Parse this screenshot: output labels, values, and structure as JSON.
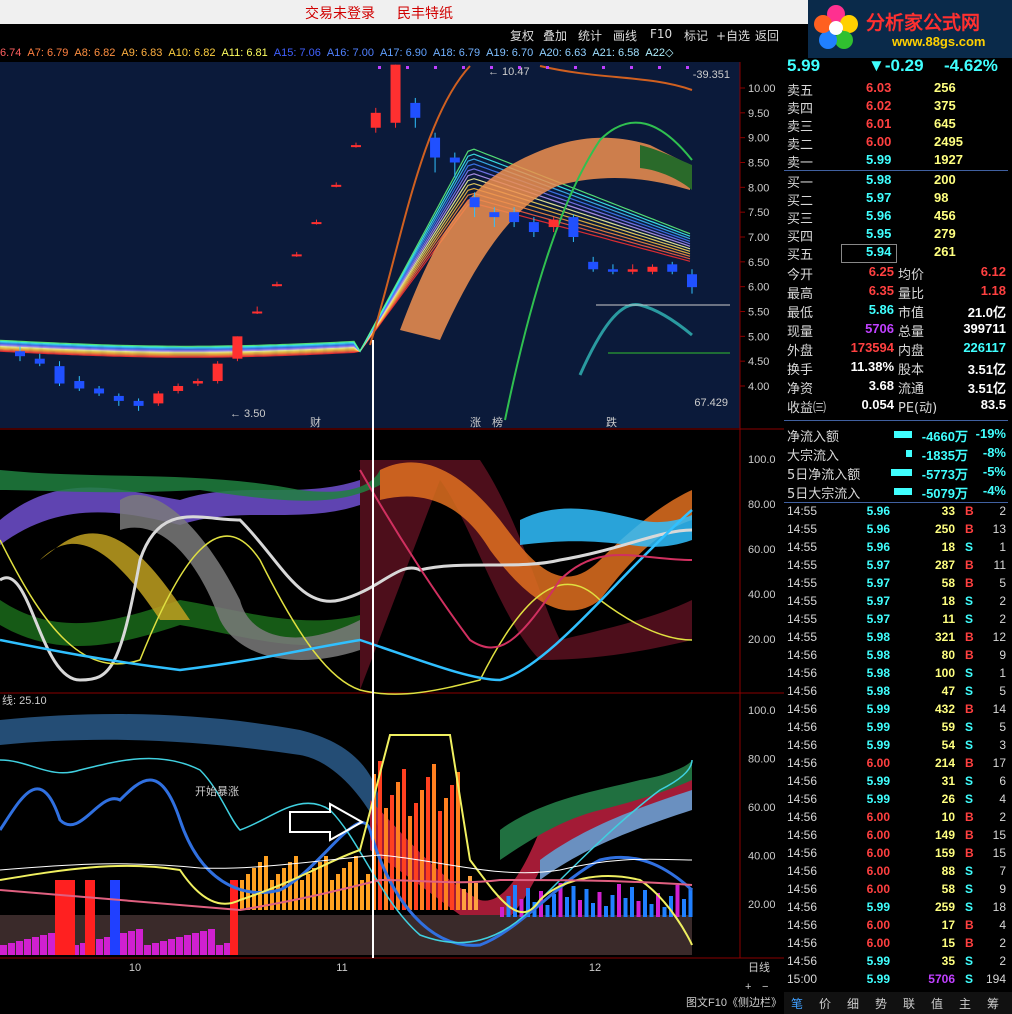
{
  "topbar": {
    "login": "交易未登录",
    "paper": "民丰特纸"
  },
  "logo": {
    "title": "分析家公式网",
    "url": "www.88gs.com"
  },
  "toolbar": [
    "复权",
    "叠加",
    "统计",
    "画线",
    "F10",
    "标记",
    "+自选",
    "返回"
  ],
  "ma_row": [
    {
      "t": "6.74",
      "c": "#ff6060"
    },
    {
      "t": "A7: 6.79",
      "c": "#ff8040"
    },
    {
      "t": "A8: 6.82",
      "c": "#ff9040"
    },
    {
      "t": "A9: 6.83",
      "c": "#ffb040"
    },
    {
      "t": "A10: 6.82",
      "c": "#ffd040"
    },
    {
      "t": "A11: 6.81",
      "c": "#ffff60"
    },
    {
      "t": "A15: 7.06",
      "c": "#4060ff"
    },
    {
      "t": "A16: 7.00",
      "c": "#5080ff"
    },
    {
      "t": "A17: 6.90",
      "c": "#60a0ff"
    },
    {
      "t": "A18: 6.79",
      "c": "#70b0ff"
    },
    {
      "t": "A19: 6.70",
      "c": "#80c0ff"
    },
    {
      "t": "A20: 6.63",
      "c": "#90d0ff"
    },
    {
      "t": "A21: 6.58",
      "c": "#a0e0ff"
    },
    {
      "t": "A22◇",
      "c": "#b0f0ff"
    }
  ],
  "main_chart": {
    "y_ticks": [
      "10.00",
      "9.50",
      "9.00",
      "8.50",
      "8.00",
      "7.50",
      "7.00",
      "6.50",
      "6.00",
      "5.50",
      "5.00",
      "4.50",
      "4.00"
    ],
    "high_label": "10.47",
    "low_label": "3.50",
    "top_right_value": "-39.351",
    "bottom_right_value": "67.429",
    "markers": [
      {
        "t": "财",
        "c": "#4080ff"
      },
      {
        "t": "涨",
        "c": "#ff3030"
      },
      {
        "t": "榜",
        "c": "#ff8000"
      },
      {
        "t": "跌",
        "c": "#30ff30"
      }
    ],
    "candles": [
      {
        "o": 4.7,
        "c": 4.6,
        "h": 4.8,
        "l": 4.5
      },
      {
        "o": 4.55,
        "c": 4.45,
        "h": 4.65,
        "l": 4.4
      },
      {
        "o": 4.4,
        "c": 4.05,
        "h": 4.5,
        "l": 4.0
      },
      {
        "o": 4.1,
        "c": 3.95,
        "h": 4.2,
        "l": 3.9
      },
      {
        "o": 3.95,
        "c": 3.85,
        "h": 4.0,
        "l": 3.8
      },
      {
        "o": 3.8,
        "c": 3.7,
        "h": 3.85,
        "l": 3.6
      },
      {
        "o": 3.7,
        "c": 3.6,
        "h": 3.75,
        "l": 3.5
      },
      {
        "o": 3.65,
        "c": 3.85,
        "h": 3.9,
        "l": 3.6
      },
      {
        "o": 3.9,
        "c": 4.0,
        "h": 4.05,
        "l": 3.85
      },
      {
        "o": 4.05,
        "c": 4.1,
        "h": 4.15,
        "l": 4.0
      },
      {
        "o": 4.1,
        "c": 4.45,
        "h": 4.5,
        "l": 4.05
      },
      {
        "o": 4.55,
        "c": 5.0,
        "h": 5.0,
        "l": 4.5
      },
      {
        "o": 5.5,
        "c": 5.5,
        "h": 5.6,
        "l": 5.45
      },
      {
        "o": 6.05,
        "c": 6.05,
        "h": 6.1,
        "l": 6.0
      },
      {
        "o": 6.65,
        "c": 6.65,
        "h": 6.7,
        "l": 6.6
      },
      {
        "o": 7.3,
        "c": 7.3,
        "h": 7.35,
        "l": 7.25
      },
      {
        "o": 8.05,
        "c": 8.05,
        "h": 8.1,
        "l": 8.0
      },
      {
        "o": 8.85,
        "c": 8.85,
        "h": 8.9,
        "l": 8.8
      },
      {
        "o": 9.2,
        "c": 9.5,
        "h": 9.6,
        "l": 9.1
      },
      {
        "o": 9.3,
        "c": 10.47,
        "h": 10.47,
        "l": 9.2
      },
      {
        "o": 9.7,
        "c": 9.4,
        "h": 9.8,
        "l": 9.2
      },
      {
        "o": 9.0,
        "c": 8.6,
        "h": 9.1,
        "l": 8.3
      },
      {
        "o": 8.6,
        "c": 8.5,
        "h": 8.7,
        "l": 8.2
      },
      {
        "o": 7.8,
        "c": 7.6,
        "h": 7.9,
        "l": 7.4
      },
      {
        "o": 7.5,
        "c": 7.4,
        "h": 7.6,
        "l": 7.2
      },
      {
        "o": 7.5,
        "c": 7.3,
        "h": 7.6,
        "l": 7.2
      },
      {
        "o": 7.3,
        "c": 7.1,
        "h": 7.4,
        "l": 7.0
      },
      {
        "o": 7.2,
        "c": 7.35,
        "h": 7.4,
        "l": 7.1
      },
      {
        "o": 7.4,
        "c": 7.0,
        "h": 7.45,
        "l": 6.9
      },
      {
        "o": 6.5,
        "c": 6.35,
        "h": 6.6,
        "l": 6.3
      },
      {
        "o": 6.35,
        "c": 6.3,
        "h": 6.45,
        "l": 6.25
      },
      {
        "o": 6.3,
        "c": 6.35,
        "h": 6.45,
        "l": 6.25
      },
      {
        "o": 6.3,
        "c": 6.4,
        "h": 6.45,
        "l": 6.25
      },
      {
        "o": 6.45,
        "c": 6.3,
        "h": 6.5,
        "l": 6.25
      },
      {
        "o": 6.25,
        "c": 5.99,
        "h": 6.35,
        "l": 5.86
      }
    ]
  },
  "ind1": {
    "y_ticks": [
      "100.0",
      "80.00",
      "60.00",
      "40.00",
      "20.00"
    ]
  },
  "ind2": {
    "label": "线: 25.10",
    "y_ticks": [
      "100.0",
      "80.00",
      "60.00",
      "40.00",
      "20.00"
    ]
  },
  "x_ticks": [
    "10",
    "11",
    "12"
  ],
  "annotation": "开始暴涨",
  "period": "日线",
  "bottom_left": "图文F10《侧边栏》",
  "quote": {
    "price": "5.99",
    "change": "▼-0.29",
    "pct": "-4.62%",
    "asks": [
      {
        "label": "卖五",
        "price": "6.03",
        "vol": "256"
      },
      {
        "label": "卖四",
        "price": "6.02",
        "vol": "375"
      },
      {
        "label": "卖三",
        "price": "6.01",
        "vol": "645"
      },
      {
        "label": "卖二",
        "price": "6.00",
        "vol": "2495"
      },
      {
        "label": "卖一",
        "price": "5.99",
        "vol": "1927"
      }
    ],
    "bids": [
      {
        "label": "买一",
        "price": "5.98",
        "vol": "200"
      },
      {
        "label": "买二",
        "price": "5.97",
        "vol": "98"
      },
      {
        "label": "买三",
        "price": "5.96",
        "vol": "456"
      },
      {
        "label": "买四",
        "price": "5.95",
        "vol": "279"
      },
      {
        "label": "买五",
        "price": "5.94",
        "vol": "261"
      }
    ],
    "stats": [
      {
        "l1": "今开",
        "v1": "6.25",
        "c1": "#ff4040",
        "l2": "均价",
        "v2": "6.12",
        "c2": "#ff4040"
      },
      {
        "l1": "最高",
        "v1": "6.35",
        "c1": "#ff4040",
        "l2": "量比",
        "v2": "1.18",
        "c2": "#ff4040"
      },
      {
        "l1": "最低",
        "v1": "5.86",
        "c1": "#40ffff",
        "l2": "市值",
        "v2": "21.0亿",
        "c2": "#ffffff"
      },
      {
        "l1": "现量",
        "v1": "5706",
        "c1": "#c040ff",
        "l2": "总量",
        "v2": "399711",
        "c2": "#ffffff"
      },
      {
        "l1": "外盘",
        "v1": "173594",
        "c1": "#ff4040",
        "l2": "内盘",
        "v2": "226117",
        "c2": "#40ffff"
      },
      {
        "l1": "换手",
        "v1": "11.38%",
        "c1": "#ffffff",
        "l2": "股本",
        "v2": "3.51亿",
        "c2": "#ffffff"
      },
      {
        "l1": "净资",
        "v1": "3.68",
        "c1": "#ffffff",
        "l2": "流通",
        "v2": "3.51亿",
        "c2": "#ffffff"
      },
      {
        "l1": "收益㈢",
        "v1": "0.054",
        "c1": "#ffffff",
        "l2": "PE(动)",
        "v2": "83.5",
        "c2": "#ffffff"
      }
    ],
    "flows": [
      {
        "label": "净流入额",
        "bar": 0.6,
        "val": "-4660万",
        "pct": "-19%"
      },
      {
        "label": "大宗流入",
        "bar": 0.2,
        "val": "-1835万",
        "pct": "-8%"
      },
      {
        "label": "5日净流入额",
        "bar": 0.7,
        "val": "-5773万",
        "pct": "-5%"
      },
      {
        "label": "5日大宗流入",
        "bar": 0.6,
        "val": "-5079万",
        "pct": "-4%"
      }
    ]
  },
  "ticks": [
    [
      "14:55",
      "5.96",
      "33",
      "B",
      "2"
    ],
    [
      "14:55",
      "5.96",
      "250",
      "B",
      "13"
    ],
    [
      "14:55",
      "5.96",
      "18",
      "S",
      "1"
    ],
    [
      "14:55",
      "5.97",
      "287",
      "B",
      "11"
    ],
    [
      "14:55",
      "5.97",
      "58",
      "B",
      "5"
    ],
    [
      "14:55",
      "5.97",
      "18",
      "S",
      "2"
    ],
    [
      "14:55",
      "5.97",
      "11",
      "S",
      "2"
    ],
    [
      "14:55",
      "5.98",
      "321",
      "B",
      "12"
    ],
    [
      "14:56",
      "5.98",
      "80",
      "B",
      "9"
    ],
    [
      "14:56",
      "5.98",
      "100",
      "S",
      "1"
    ],
    [
      "14:56",
      "5.98",
      "47",
      "S",
      "5"
    ],
    [
      "14:56",
      "5.99",
      "432",
      "B",
      "14"
    ],
    [
      "14:56",
      "5.99",
      "59",
      "S",
      "5"
    ],
    [
      "14:56",
      "5.99",
      "54",
      "S",
      "3"
    ],
    [
      "14:56",
      "6.00",
      "214",
      "B",
      "17"
    ],
    [
      "14:56",
      "5.99",
      "31",
      "S",
      "6"
    ],
    [
      "14:56",
      "5.99",
      "26",
      "S",
      "4"
    ],
    [
      "14:56",
      "6.00",
      "10",
      "B",
      "2"
    ],
    [
      "14:56",
      "6.00",
      "149",
      "B",
      "15"
    ],
    [
      "14:56",
      "6.00",
      "159",
      "B",
      "15"
    ],
    [
      "14:56",
      "6.00",
      "88",
      "S",
      "7"
    ],
    [
      "14:56",
      "6.00",
      "58",
      "S",
      "9"
    ],
    [
      "14:56",
      "5.99",
      "259",
      "S",
      "18"
    ],
    [
      "14:56",
      "6.00",
      "17",
      "B",
      "4"
    ],
    [
      "14:56",
      "6.00",
      "15",
      "B",
      "2"
    ],
    [
      "14:56",
      "5.99",
      "35",
      "S",
      "2"
    ],
    [
      "15:00",
      "5.99",
      "5706",
      "S",
      "194"
    ]
  ],
  "side_tabs": [
    "笔",
    "价",
    "细",
    "势",
    "联",
    "值",
    "主",
    "筹"
  ]
}
